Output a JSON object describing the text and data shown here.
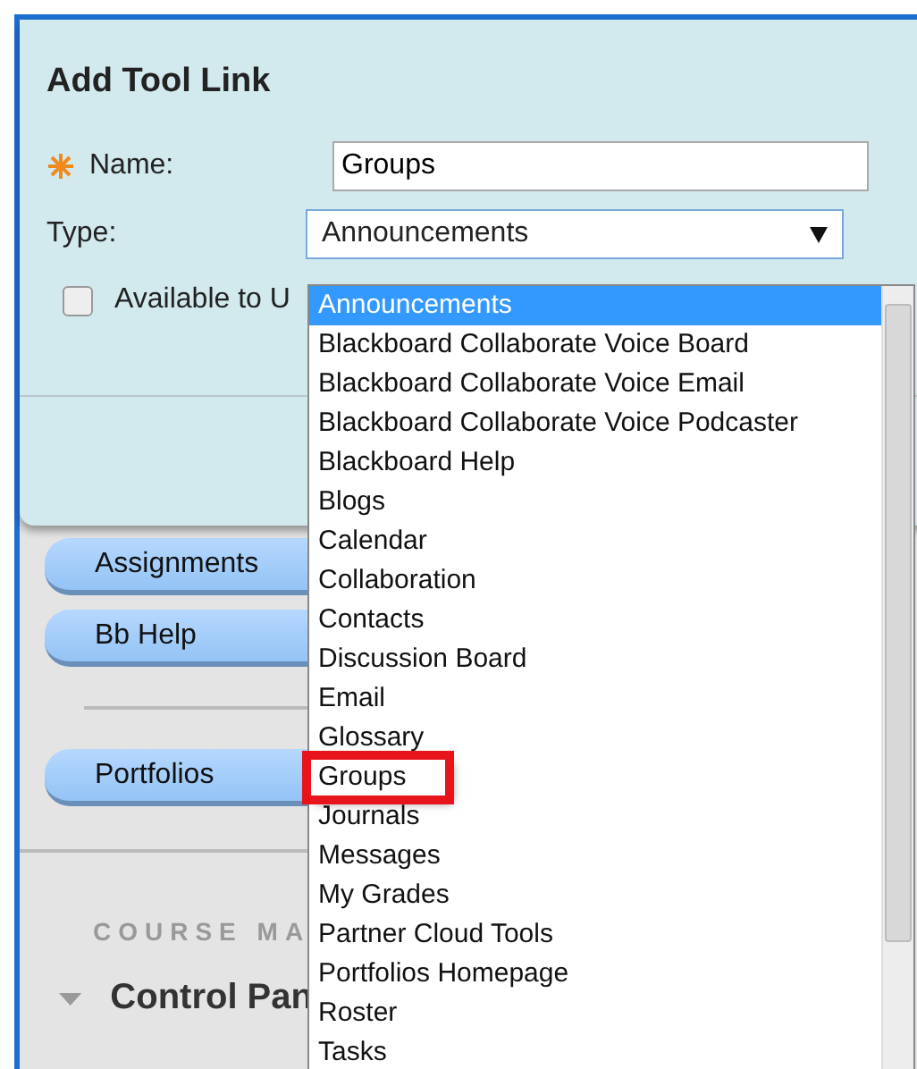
{
  "dialog": {
    "title": "Add Tool Link",
    "name_label": "Name:",
    "name_value": "Groups",
    "type_label": "Type:",
    "type_value": "Announcements",
    "available_label": "Available to U",
    "available_checked": false
  },
  "dropdown": {
    "items": [
      {
        "label": "Announcements",
        "selected": true,
        "highlighted": false
      },
      {
        "label": "Blackboard Collaborate Voice Board",
        "selected": false,
        "highlighted": false
      },
      {
        "label": "Blackboard Collaborate Voice Email",
        "selected": false,
        "highlighted": false
      },
      {
        "label": "Blackboard Collaborate Voice Podcaster",
        "selected": false,
        "highlighted": false
      },
      {
        "label": "Blackboard Help",
        "selected": false,
        "highlighted": false
      },
      {
        "label": "Blogs",
        "selected": false,
        "highlighted": false
      },
      {
        "label": "Calendar",
        "selected": false,
        "highlighted": false
      },
      {
        "label": "Collaboration",
        "selected": false,
        "highlighted": false
      },
      {
        "label": "Contacts",
        "selected": false,
        "highlighted": false
      },
      {
        "label": "Discussion Board",
        "selected": false,
        "highlighted": false
      },
      {
        "label": "Email",
        "selected": false,
        "highlighted": false
      },
      {
        "label": "Glossary",
        "selected": false,
        "highlighted": false
      },
      {
        "label": "Groups",
        "selected": false,
        "highlighted": true
      },
      {
        "label": "Journals",
        "selected": false,
        "highlighted": false
      },
      {
        "label": "Messages",
        "selected": false,
        "highlighted": false
      },
      {
        "label": "My Grades",
        "selected": false,
        "highlighted": false
      },
      {
        "label": "Partner Cloud Tools",
        "selected": false,
        "highlighted": false
      },
      {
        "label": "Portfolios Homepage",
        "selected": false,
        "highlighted": false
      },
      {
        "label": "Roster",
        "selected": false,
        "highlighted": false
      },
      {
        "label": "Tasks",
        "selected": false,
        "highlighted": false
      }
    ]
  },
  "sidebar": {
    "buttons": [
      {
        "label": "Assignments"
      },
      {
        "label": "Bb Help"
      },
      {
        "label": "Portfolios"
      }
    ],
    "section_heading": "COURSE MA",
    "control_panel": "Control Pan"
  }
}
